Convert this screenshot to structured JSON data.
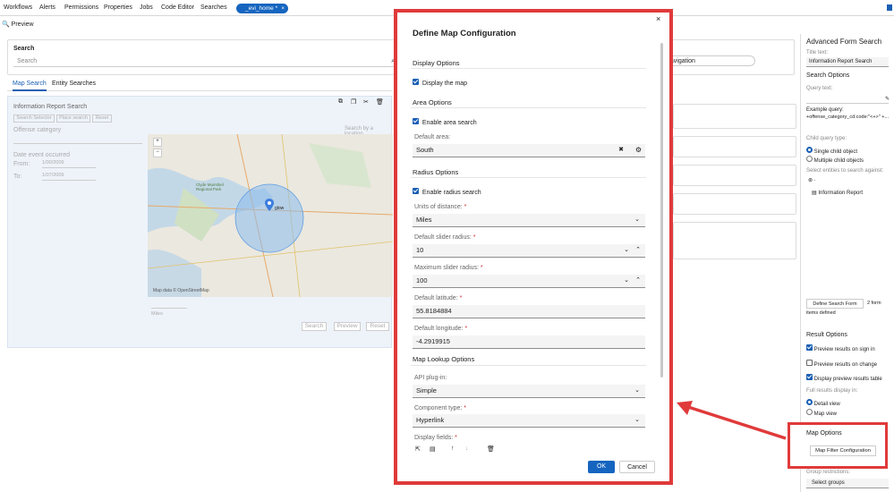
{
  "menu": [
    "Workflows",
    "Alerts",
    "Permissions",
    "Properties",
    "Jobs",
    "Code Editor",
    "Searches"
  ],
  "env_tab": "_evi_home *",
  "preview_label": "Preview",
  "search": {
    "label": "Search",
    "placeholder": "Search"
  },
  "tabs": [
    "Map Search",
    "Entity Searches"
  ],
  "form": {
    "title": "Information Report Search",
    "buttons": [
      "Search Selector",
      "Place search",
      "Reset"
    ],
    "offense_label": "Offense category",
    "date_label": "Date event occurred",
    "from_label": "From:",
    "to_label": "To:",
    "from_val": "1/00/2009",
    "to_val": "1/07/2009",
    "search_link": "Search by a location",
    "map_credit": "Map data © OpenStreetMap",
    "map_place": "glow",
    "map_area": "Clyde Muirshiel Regional Park",
    "miles": "Miles",
    "bottom_buttons": [
      "Search",
      "Preview",
      "Reset"
    ]
  },
  "bg_nav_text": "navigation",
  "modal": {
    "title": "Define Map Configuration",
    "display_options": "Display Options",
    "display_map": "Display the map",
    "area_options": "Area Options",
    "enable_area": "Enable area search",
    "default_area_label": "Default area:",
    "default_area": "South",
    "radius_options": "Radius Options",
    "enable_radius": "Enable radius search",
    "units_label": "Units of distance:",
    "units": "Miles",
    "default_radius_label": "Default slider radius:",
    "default_radius": "10",
    "max_radius_label": "Maximum slider radius:",
    "max_radius": "100",
    "lat_label": "Default latitude:",
    "lat": "55.8184884",
    "lon_label": "Default longitude:",
    "lon": "-4.2919915",
    "lookup_options": "Map Lookup Options",
    "api_label": "API plug-in:",
    "api": "Simple",
    "component_label": "Component type:",
    "component": "Hyperlink",
    "display_fields_label": "Display fields:",
    "ok": "OK",
    "cancel": "Cancel",
    "req": "*"
  },
  "right": {
    "title": "Advanced Form Search",
    "title_text_label": "Title text:",
    "title_text": "Information Report Search",
    "search_options": "Search Options",
    "query_text_label": "Query text:",
    "example_label": "Example query:",
    "example_query": "+offense_category_cd.code:\"<+>\" +...",
    "child_type_label": "Child query type:",
    "single_child": "Single child object",
    "multiple_child": "Multiple child objects",
    "select_entities_label": "Select entities to search against:",
    "entity": "Information Report",
    "define_btn": "Define Search Form",
    "defined_count": "2 form",
    "items_defined": "items defined",
    "result_options": "Result Options",
    "res1": "Preview results on sign in",
    "res2": "Preview results on change",
    "res3": "Display preview results table",
    "full_display_label": "Full results display in:",
    "detail_view": "Detail view",
    "map_view": "Map view",
    "map_options": "Map Options",
    "map_filter_btn": "Map Filter Configuration",
    "group_label": "Group restrictions:",
    "group_placeholder": "Select groups"
  },
  "colors": {
    "accent": "#1a5fb4",
    "highlight": "#e03a3a"
  }
}
